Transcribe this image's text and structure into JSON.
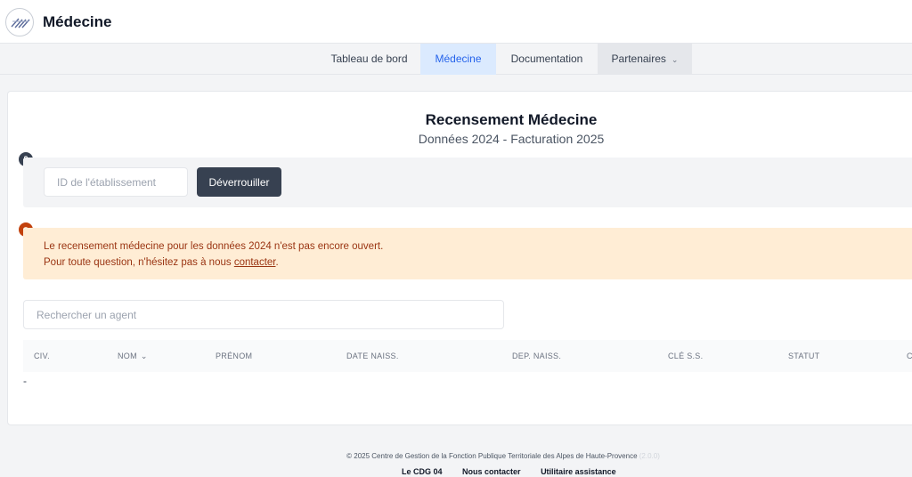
{
  "header": {
    "app_title": "Médecine",
    "logo_icon": "cdg-logo"
  },
  "nav": {
    "items": [
      {
        "label": "Tableau de bord",
        "active": false
      },
      {
        "label": "Médecine",
        "active": true
      },
      {
        "label": "Documentation",
        "active": false
      },
      {
        "label": "Partenaires",
        "active": false,
        "has_dropdown": true
      }
    ]
  },
  "page": {
    "title": "Recensement Médecine",
    "subtitle": "Données 2024 - Facturation 2025"
  },
  "unlock": {
    "input_placeholder": "ID de l'établissement",
    "input_value": "",
    "button_label": "Déverrouiller"
  },
  "alert": {
    "line1": "Le recensement médecine pour les données 2024 n'est pas encore ouvert.",
    "line2_prefix": "Pour toute question, n'hésitez pas à nous ",
    "line2_link": "contacter",
    "line2_suffix": "."
  },
  "search": {
    "placeholder": "Rechercher un agent"
  },
  "table": {
    "columns": [
      "CIV.",
      "NOM",
      "PRÉNOM",
      "DATE NAISS.",
      "DEP. NAISS.",
      "CLÉ S.S.",
      "STATUT",
      "C"
    ],
    "empty_value": "-"
  },
  "footer": {
    "copyright": "© 2025 Centre de Gestion de la Fonction Publique Territoriale des Alpes de Haute-Provence",
    "version": "(2.0.0)",
    "links": [
      "Le CDG 04",
      "Nous contacter",
      "Utilitaire assistance"
    ]
  },
  "colors": {
    "accent": "#2563eb",
    "alert_bg": "#ffedd5",
    "alert_text": "#9a3412",
    "button_dark": "#374151"
  }
}
